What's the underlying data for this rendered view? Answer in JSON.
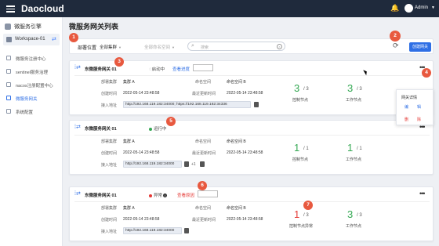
{
  "topbar": {
    "brand": "Daocloud",
    "user": "Admin"
  },
  "sidebar": {
    "header": "微服务引擎",
    "workspace": "Workspace-01",
    "items": [
      {
        "label": "微服务注册中心"
      },
      {
        "label": "sentinel服务治理"
      },
      {
        "label": "nacos注册配置中心"
      },
      {
        "label": "微服务网关",
        "active": true
      },
      {
        "label": "系统配置"
      }
    ]
  },
  "page": {
    "title": "微服务网关列表"
  },
  "filter": {
    "deploy_label": "部署位置",
    "cluster": "全部集群",
    "namespace": "全部命名空间",
    "search_placeholder": "搜索",
    "create_button": "创建网关"
  },
  "labels": {
    "cluster": "部署集群",
    "namespace": "命名空间",
    "created": "创建时间",
    "updated": "最近更新时间",
    "address": "接入地址",
    "control_nodes": "控制节点",
    "worker_nodes": "工作节点",
    "control_nodes_error": "控制节点异常",
    "view_progress": "查看进度",
    "view_reason": "查看原因"
  },
  "gateways": [
    {
      "name": "东微服务网关 01",
      "status": "启动中",
      "status_color": "#999999",
      "cluster": "集群 A",
      "namespace": "命名空间 B",
      "created": "2022-05-14 23:48:58",
      "updated": "2022-05-14 23:48:58",
      "address": "http://192.168.119.182:34000; https://192.168.119.182:34336",
      "control_ok": "3",
      "control_total": "/ 3",
      "worker_ok": "3",
      "worker_total": "/ 3"
    },
    {
      "name": "东微服务网关 01",
      "status": "运行中",
      "status_color": "#34a853",
      "cluster": "集群 A",
      "namespace": "命名空间 B",
      "created": "2022-05-14 23:48:58",
      "updated": "2022-05-14 23:48:58",
      "address": "http://192.168.119.182:34000",
      "extra": "+1",
      "control_ok": "1",
      "control_total": "/ 1",
      "worker_ok": "1",
      "worker_total": "/ 1"
    },
    {
      "name": "东微服务网关 01",
      "status": "异常",
      "status_color": "#e53935",
      "cluster": "集群 A",
      "namespace": "命名空间 B",
      "created": "2022-05-14 23:48:58",
      "updated": "2022-05-14 23:48:58",
      "address": "http://192.168.119.182:34000",
      "control_ok": "1",
      "control_total": "/ 3",
      "worker_ok": "3",
      "worker_total": "/ 3"
    }
  ],
  "context_menu": {
    "title": "网关详情",
    "edit": "编",
    "edit2": "辑",
    "del1": "删",
    "del2": "除"
  },
  "markers": [
    "1",
    "2",
    "3",
    "4",
    "5",
    "6",
    "7"
  ]
}
